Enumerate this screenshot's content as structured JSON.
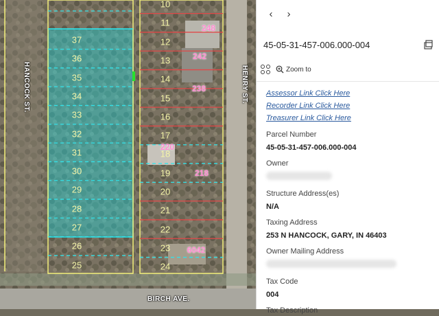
{
  "map": {
    "streets": {
      "left": "HANCOCK ST.",
      "right": "HENRY ST.",
      "bottom": "BIRCH AVE."
    },
    "left_block_lots": [
      "37",
      "36",
      "35",
      "34",
      "33",
      "32",
      "31",
      "30",
      "29",
      "28",
      "27",
      "26",
      "25"
    ],
    "right_block_lots": [
      "10",
      "11",
      "12",
      "13",
      "14",
      "15",
      "16",
      "17",
      "18",
      "19",
      "20",
      "21",
      "22",
      "23",
      "24"
    ],
    "addresses": [
      "248",
      "242",
      "238",
      "220",
      "218",
      "6042"
    ],
    "colors": {
      "selected_fill": "#22d3d8",
      "parcel_yellow": "#f3ef7a",
      "lot_line_cyan": "#34e1e8",
      "lot_line_red": "#e14848",
      "address_pink": "#ff8ad0"
    }
  },
  "panel": {
    "nav": {
      "back_icon": "chevron-left-icon",
      "forward_icon": "chevron-right-icon"
    },
    "title": "45-05-31-457-006.000-004",
    "dock_icon": "dock-icon",
    "toolbar": {
      "group_icon": "four-circles-icon",
      "zoom_icon": "zoom-in-icon",
      "zoom_label": "Zoom to"
    },
    "links": [
      "Assessor Link Click Here",
      "Recorder Link Click Here",
      "Treasurer Link Click Here"
    ],
    "fields": [
      {
        "label": "Parcel Number",
        "value": "45-05-31-457-006.000-004"
      },
      {
        "label": "Owner",
        "value": "",
        "redacted": true
      },
      {
        "label": "Structure Address(es)",
        "value": "N/A"
      },
      {
        "label": "Taxing Address",
        "value": "253 N HANCOCK, GARY, IN 46403"
      },
      {
        "label": "Owner Mailing Address",
        "value": "",
        "redacted": true
      },
      {
        "label": "Tax Code",
        "value": "004"
      },
      {
        "label": "Tax Description",
        "value": ""
      }
    ]
  }
}
